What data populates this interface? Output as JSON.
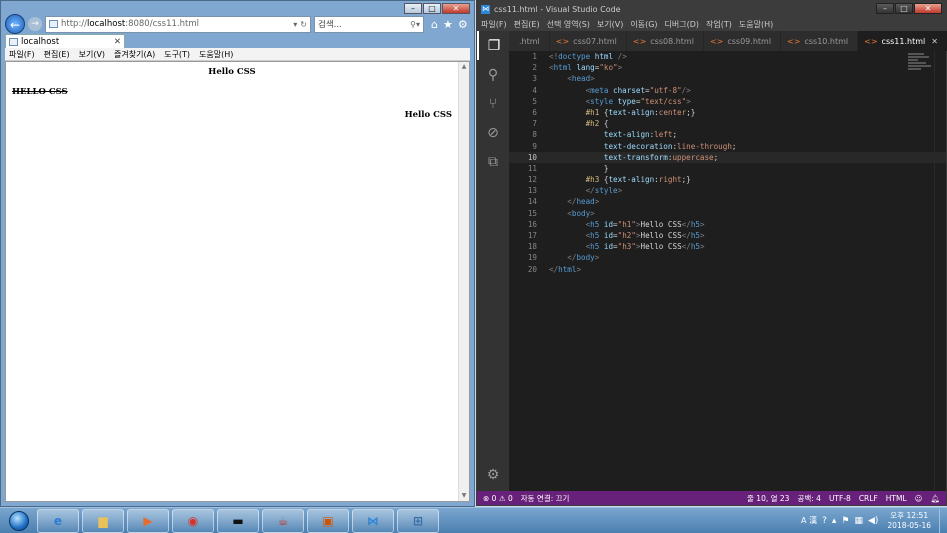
{
  "ie": {
    "address": {
      "prefix": "http://",
      "host": "localhost",
      "rest": ":8080/css11.html"
    },
    "search_placeholder": "검색...",
    "tab_title": "localhost",
    "menu": [
      "파일(F)",
      "편집(E)",
      "보기(V)",
      "즐겨찾기(A)",
      "도구(T)",
      "도움말(H)"
    ],
    "content": {
      "h1": "Hello CSS",
      "h2": "Hello CSS",
      "h3": "Hello CSS"
    }
  },
  "vscode": {
    "title": "css11.html - Visual Studio Code",
    "menu": [
      "파일(F)",
      "편집(E)",
      "선택 영역(S)",
      "보기(V)",
      "이동(G)",
      "디버그(D)",
      "작업(T)",
      "도움말(H)"
    ],
    "tabs": [
      {
        "label": ".html",
        "active": false
      },
      {
        "label": "css07.html",
        "active": false
      },
      {
        "label": "css08.html",
        "active": false
      },
      {
        "label": "css09.html",
        "active": false
      },
      {
        "label": "css10.html",
        "active": false
      },
      {
        "label": "css11.html",
        "active": true
      }
    ],
    "current_line": 10,
    "code": [
      [
        [
          "g",
          "<!"
        ],
        [
          "t",
          "doctype"
        ],
        [
          "",
          "&nbsp;"
        ],
        [
          "a",
          "html"
        ],
        [
          "",
          ""
        ],
        [
          "g",
          " />"
        ]
      ],
      [
        [
          "g",
          "<"
        ],
        [
          "t",
          "html"
        ],
        [
          "",
          " "
        ],
        [
          "a",
          "lang"
        ],
        [
          "",
          "="
        ],
        [
          "s",
          "\"ko\""
        ],
        [
          "g",
          ">"
        ]
      ],
      [
        [
          "",
          "    "
        ],
        [
          "g",
          "<"
        ],
        [
          "t",
          "head"
        ],
        [
          "g",
          ">"
        ]
      ],
      [
        [
          "",
          "        "
        ],
        [
          "g",
          "<"
        ],
        [
          "t",
          "meta"
        ],
        [
          "",
          " "
        ],
        [
          "a",
          "charset"
        ],
        [
          "",
          "="
        ],
        [
          "s",
          "\"utf-8\""
        ],
        [
          "g",
          "/>"
        ]
      ],
      [
        [
          "",
          "        "
        ],
        [
          "g",
          "<"
        ],
        [
          "t",
          "style"
        ],
        [
          "",
          " "
        ],
        [
          "a",
          "type"
        ],
        [
          "",
          "="
        ],
        [
          "s",
          "\"text/css\""
        ],
        [
          "g",
          ">"
        ]
      ],
      [
        [
          "",
          "        "
        ],
        [
          "v",
          "#h1"
        ],
        [
          "",
          " {"
        ],
        [
          "a",
          "text-align"
        ],
        [
          "",
          ":"
        ],
        [
          "s",
          "center"
        ],
        [
          "",
          ";}"
        ]
      ],
      [
        [
          "",
          "        "
        ],
        [
          "v",
          "#h2"
        ],
        [
          "",
          " {"
        ]
      ],
      [
        [
          "",
          "            "
        ],
        [
          "a",
          "text-align"
        ],
        [
          "",
          ":"
        ],
        [
          "s",
          "left"
        ],
        [
          "",
          ";"
        ]
      ],
      [
        [
          "",
          "            "
        ],
        [
          "a",
          "text-decoration"
        ],
        [
          "",
          ":"
        ],
        [
          "s",
          "line-through"
        ],
        [
          "",
          ";"
        ]
      ],
      [
        [
          "",
          "            "
        ],
        [
          "a",
          "text-transform"
        ],
        [
          "",
          ":"
        ],
        [
          "s",
          "uppercase"
        ],
        [
          "",
          ";"
        ]
      ],
      [
        [
          "",
          "            }"
        ]
      ],
      [
        [
          "",
          "        "
        ],
        [
          "v",
          "#h3"
        ],
        [
          "",
          " {"
        ],
        [
          "a",
          "text-align"
        ],
        [
          "",
          ":"
        ],
        [
          "s",
          "right"
        ],
        [
          "",
          ";}"
        ]
      ],
      [
        [
          "",
          "        "
        ],
        [
          "g",
          "</"
        ],
        [
          "t",
          "style"
        ],
        [
          "g",
          ">"
        ]
      ],
      [
        [
          "",
          "    "
        ],
        [
          "g",
          "</"
        ],
        [
          "t",
          "head"
        ],
        [
          "g",
          ">"
        ]
      ],
      [
        [
          "",
          "    "
        ],
        [
          "g",
          "<"
        ],
        [
          "t",
          "body"
        ],
        [
          "g",
          ">"
        ]
      ],
      [
        [
          "",
          "        "
        ],
        [
          "g",
          "<"
        ],
        [
          "t",
          "h5"
        ],
        [
          "",
          " "
        ],
        [
          "a",
          "id"
        ],
        [
          "",
          "="
        ],
        [
          "s",
          "\"h1\""
        ],
        [
          "g",
          ">"
        ],
        [
          "",
          "Hello CSS"
        ],
        [
          "g",
          "</"
        ],
        [
          "t",
          "h5"
        ],
        [
          "g",
          ">"
        ]
      ],
      [
        [
          "",
          "        "
        ],
        [
          "g",
          "<"
        ],
        [
          "t",
          "h5"
        ],
        [
          "",
          " "
        ],
        [
          "a",
          "id"
        ],
        [
          "",
          "="
        ],
        [
          "s",
          "\"h2\""
        ],
        [
          "g",
          ">"
        ],
        [
          "",
          "Hello CSS"
        ],
        [
          "g",
          "</"
        ],
        [
          "t",
          "h5"
        ],
        [
          "g",
          ">"
        ]
      ],
      [
        [
          "",
          "        "
        ],
        [
          "g",
          "<"
        ],
        [
          "t",
          "h5"
        ],
        [
          "",
          " "
        ],
        [
          "a",
          "id"
        ],
        [
          "",
          "="
        ],
        [
          "s",
          "\"h3\""
        ],
        [
          "g",
          ">"
        ],
        [
          "",
          "Hello CSS"
        ],
        [
          "g",
          "</"
        ],
        [
          "t",
          "h5"
        ],
        [
          "g",
          ">"
        ]
      ],
      [
        [
          "",
          "    "
        ],
        [
          "g",
          "</"
        ],
        [
          "t",
          "body"
        ],
        [
          "g",
          ">"
        ]
      ],
      [
        [
          "g",
          "</"
        ],
        [
          "t",
          "html"
        ],
        [
          "g",
          ">"
        ]
      ]
    ],
    "status": {
      "errors": "0",
      "warnings": "0",
      "autosave": "자동 연결: 끄기",
      "position": "줄 10, 열 23",
      "indent": "공백: 4",
      "encoding": "UTF-8",
      "eol": "CRLF",
      "language": "HTML"
    }
  },
  "taskbar": {
    "ime": "A 漢",
    "time": "오후 12:51",
    "date": "2018-05-16"
  }
}
